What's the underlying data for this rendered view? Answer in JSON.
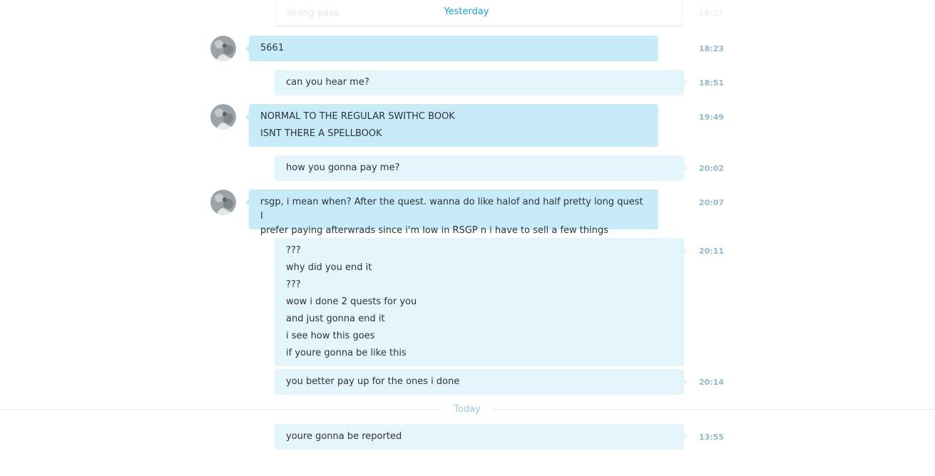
{
  "ghost": {
    "text": "wrong pass",
    "time": "18:1?"
  },
  "day_labels": {
    "yesterday": "Yesterday",
    "today": "Today"
  },
  "messages": [
    {
      "dir": "in",
      "lines": [
        "5661"
      ],
      "time": "18:23"
    },
    {
      "dir": "out",
      "lines": [
        "can you hear me?"
      ],
      "time": "18:51"
    },
    {
      "dir": "in",
      "lines": [
        "NORMAL TO THE REGULAR SWITHC BOOK",
        "ISNT THERE A SPELLBOOK"
      ],
      "time": "19:49"
    },
    {
      "dir": "out",
      "lines": [
        "how you gonna pay me?"
      ],
      "time": "20:02"
    },
    {
      "dir": "in",
      "lines": [
        "rsgp, i mean when? After the quest. wanna do like halof and half pretty long quest I",
        "prefer paying afterwrads since i'm low in RSGP n i have to sell a few things"
      ],
      "time": "20:07"
    },
    {
      "dir": "out",
      "lines": [
        "???",
        "why did you end it",
        "???",
        "wow i done 2 quests for you",
        "and just gonna end it",
        "i see how this goes",
        "if youre gonna be like this"
      ],
      "time": "20:11"
    },
    {
      "dir": "out",
      "lines": [
        "you better pay up for the ones i done"
      ],
      "time": "20:14"
    },
    {
      "dir": "out",
      "lines": [
        "youre gonna be reported"
      ],
      "time": "13:55"
    }
  ],
  "colors": {
    "incoming_bubble": "#c7ebf9",
    "outgoing_bubble": "#e4f5fc",
    "accent": "#1ea0d2",
    "timestamp": "#8fb9cd"
  }
}
